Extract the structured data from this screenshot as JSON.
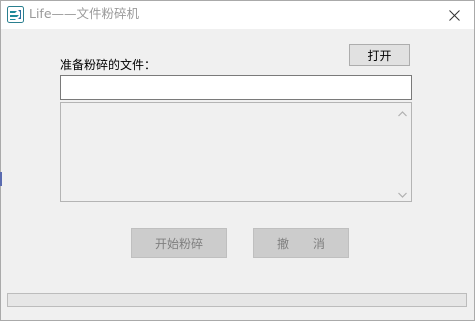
{
  "window": {
    "title": "Life——文件粉碎机",
    "icon": "shredder-app-icon",
    "close_glyph": "✕"
  },
  "toolbar": {
    "open_label": "打开"
  },
  "form": {
    "file_label": "准备粉碎的文件：",
    "file_value": "",
    "file_placeholder": ""
  },
  "file_list": {
    "items": [],
    "scroll_up_icon": "chevron-up-icon",
    "scroll_down_icon": "chevron-down-icon"
  },
  "actions": {
    "start_label": "开始粉碎",
    "cancel_label": "撤　　消",
    "enabled": false
  },
  "progress": {
    "value": 0
  },
  "colors": {
    "disabled_text": "#7f7f7f",
    "window_bg": "#f0f0f0",
    "title_text": "#9a9a9a"
  }
}
